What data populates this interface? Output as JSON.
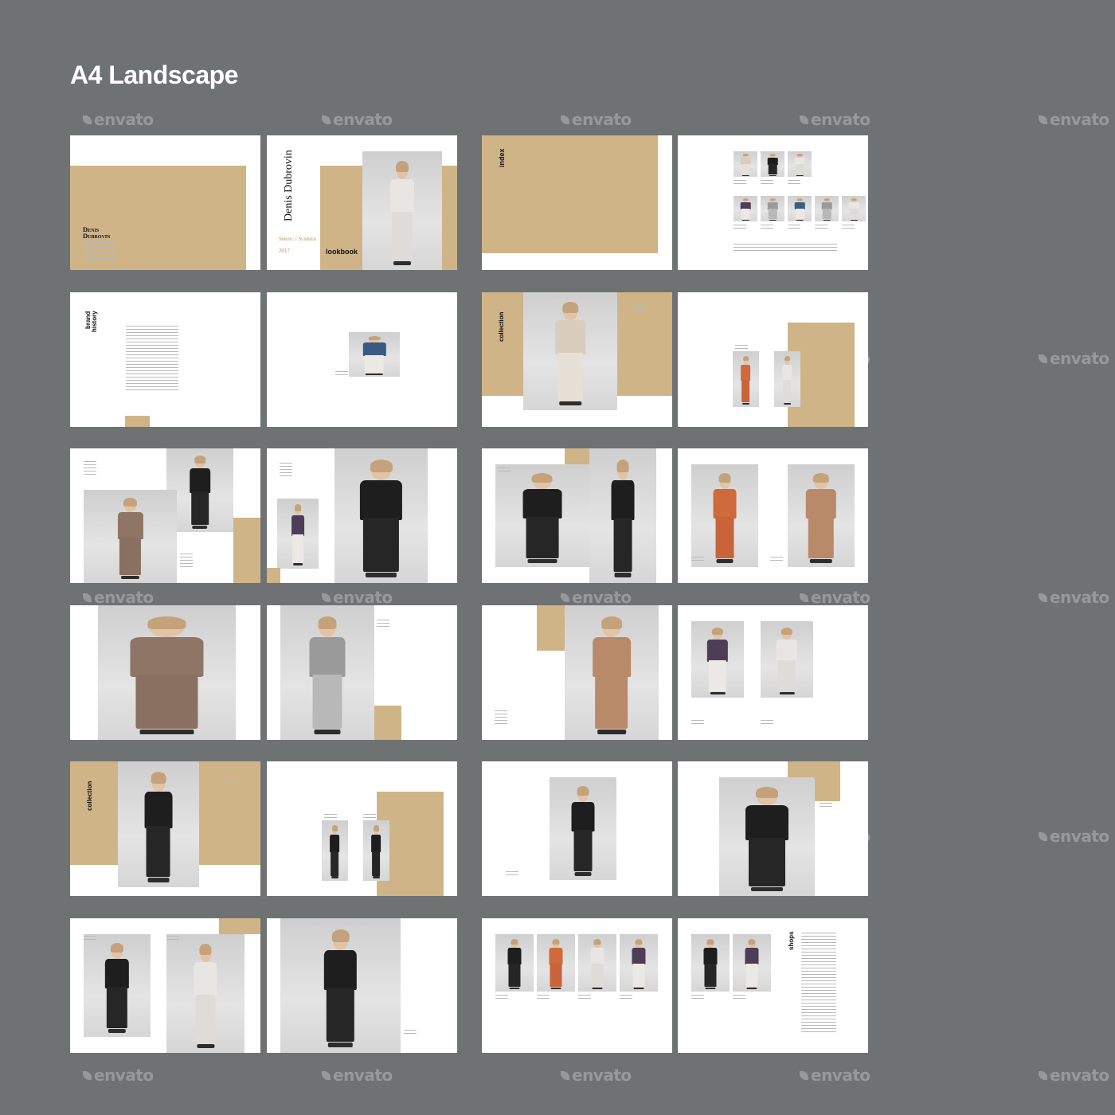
{
  "heading": "A4 Landscape",
  "watermark": "envato",
  "colors": {
    "background": "#6f7272",
    "accent": "#cfb488",
    "page": "#ffffff"
  },
  "cover": {
    "designer": "Denis Dubrovin",
    "season": "Spring / Summer",
    "year": "2017",
    "title": "lookbook"
  },
  "sections": {
    "index": "index",
    "brand": "brand",
    "history": "history",
    "collection": "collection",
    "shops": "shops"
  },
  "pages": [
    {
      "name": "page-back-cover",
      "kind": "cover-back"
    },
    {
      "name": "page-front-cover",
      "kind": "cover-front"
    },
    {
      "name": "page-index-left",
      "kind": "section"
    },
    {
      "name": "page-index-right",
      "kind": "thumbnails"
    },
    {
      "name": "page-brand-history",
      "kind": "text"
    },
    {
      "name": "page-small-photo",
      "kind": "photo"
    },
    {
      "name": "page-collection-opener",
      "kind": "photo"
    },
    {
      "name": "page-two-looks",
      "kind": "photo"
    },
    {
      "name": "page-coat",
      "kind": "photo"
    },
    {
      "name": "page-two-models",
      "kind": "photo"
    },
    {
      "name": "page-black-dress",
      "kind": "photo"
    },
    {
      "name": "page-orange-dresses",
      "kind": "photo"
    },
    {
      "name": "page-coat-detail",
      "kind": "photo"
    },
    {
      "name": "page-grey-sweater",
      "kind": "photo"
    },
    {
      "name": "page-wide-pants",
      "kind": "photo"
    },
    {
      "name": "page-two-outfits",
      "kind": "photo"
    },
    {
      "name": "page-collection-black",
      "kind": "photo"
    },
    {
      "name": "page-black-looks",
      "kind": "photo"
    },
    {
      "name": "page-black-shorts",
      "kind": "photo"
    },
    {
      "name": "page-profile",
      "kind": "photo"
    },
    {
      "name": "page-black-white",
      "kind": "photo"
    },
    {
      "name": "page-pants-closeup",
      "kind": "photo"
    },
    {
      "name": "page-four-looks",
      "kind": "photo"
    },
    {
      "name": "page-shops",
      "kind": "text"
    }
  ]
}
